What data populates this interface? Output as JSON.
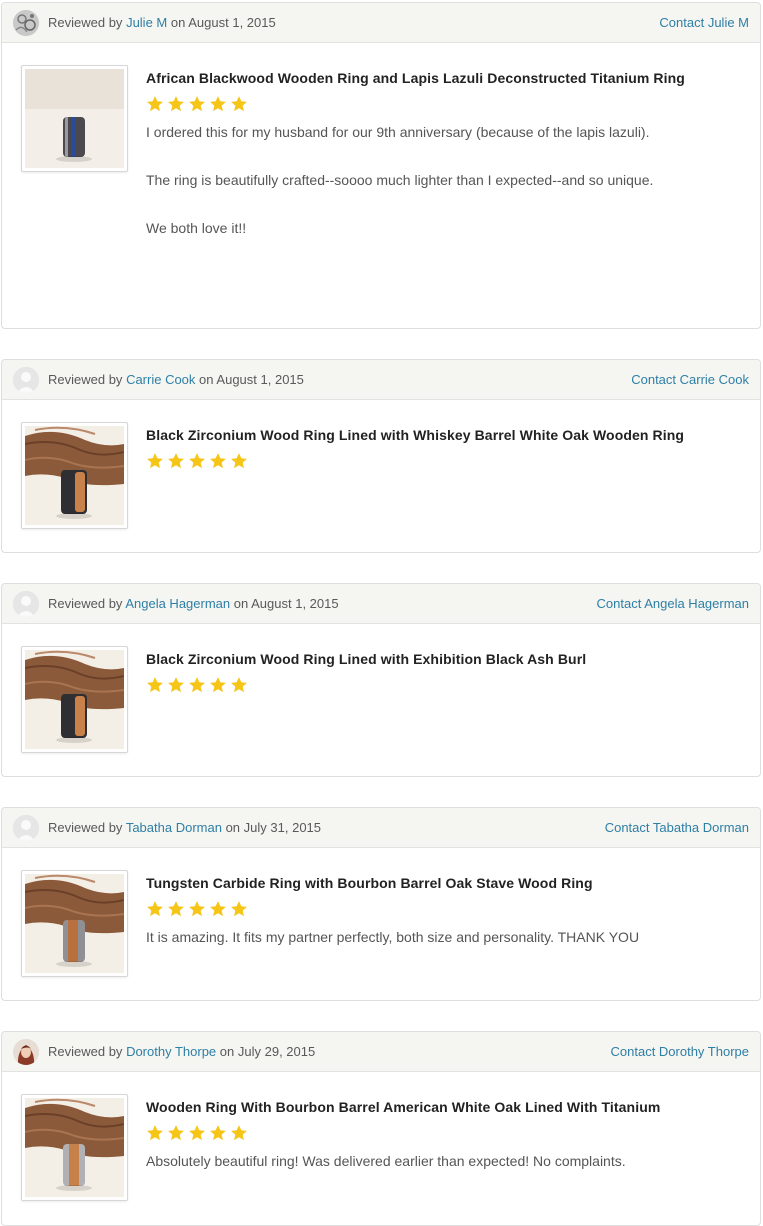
{
  "reviewed_by_prefix": "Reviewed by",
  "on_word": "on",
  "colors": {
    "link": "#2e7fa6",
    "star": "#f5c518",
    "header_bg": "#f5f5f1"
  },
  "reviews": [
    {
      "reviewer": "Julie M",
      "date": "August 1, 2015",
      "contact_label": "Contact Julie M",
      "avatar": "patterned-avatar",
      "product_image": "ring-blackwood-lapis",
      "product_title": "African Blackwood Wooden Ring and Lapis Lazuli Deconstructed Titanium Ring",
      "rating": 5,
      "paragraphs": [
        "I ordered this for my husband for our 9th anniversary (because of the lapis lazuli).",
        "The ring is beautifully crafted--soooo much lighter than I expected--and so unique.",
        "We both love it!!"
      ]
    },
    {
      "reviewer": "Carrie Cook",
      "date": "August 1, 2015",
      "contact_label": "Contact Carrie Cook",
      "avatar": "default-avatar",
      "product_image": "ring-zirconium-whiskey-oak",
      "product_title": "Black Zirconium Wood Ring Lined with Whiskey Barrel White Oak Wooden Ring",
      "rating": 5,
      "paragraphs": []
    },
    {
      "reviewer": "Angela Hagerman",
      "date": "August 1, 2015",
      "contact_label": "Contact Angela Hagerman",
      "avatar": "default-avatar",
      "product_image": "ring-zirconium-ash-burl",
      "product_title": "Black Zirconium Wood Ring Lined with Exhibition Black Ash Burl",
      "rating": 5,
      "paragraphs": []
    },
    {
      "reviewer": "Tabatha Dorman",
      "date": "July 31, 2015",
      "contact_label": "Contact Tabatha Dorman",
      "avatar": "default-avatar",
      "product_image": "ring-tungsten-bourbon-oak",
      "product_title": "Tungsten Carbide Ring with Bourbon Barrel Oak Stave Wood Ring",
      "rating": 5,
      "paragraphs": [
        "It is amazing. It fits my partner perfectly, both size and personality. THANK YOU"
      ]
    },
    {
      "reviewer": "Dorothy Thorpe",
      "date": "July 29, 2015",
      "contact_label": "Contact Dorothy Thorpe",
      "avatar": "photo-avatar",
      "product_image": "ring-bourbon-oak-titanium",
      "product_title": "Wooden Ring With Bourbon Barrel American White Oak Lined With Titanium",
      "rating": 5,
      "paragraphs": [
        "Absolutely beautiful ring! Was delivered earlier than expected! No complaints."
      ]
    }
  ]
}
